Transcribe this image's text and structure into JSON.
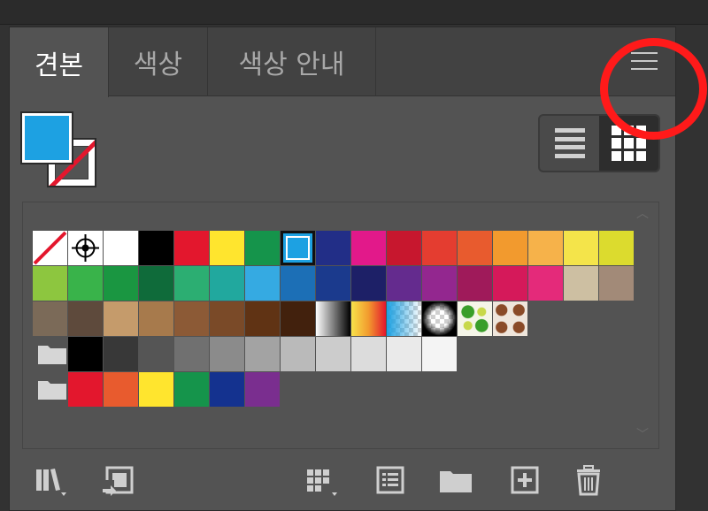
{
  "tabs": [
    {
      "label": "견본"
    },
    {
      "label": "색상"
    },
    {
      "label": "색상 안내"
    }
  ],
  "colors": {
    "fill": "#1da1e2",
    "stroke": "none",
    "highlight_ring": "#ff1a1a"
  },
  "icons": {
    "panel_menu": "hamburger-menu-icon",
    "list_view": "list-view-icon",
    "grid_view": "grid-view-icon",
    "library": "swatch-library-icon",
    "place": "place-swatches-icon",
    "kind": "show-swatch-kinds-icon",
    "options": "swatch-options-icon",
    "new_group": "new-color-group-icon",
    "new_swatch": "new-swatch-icon",
    "delete": "trash-icon"
  },
  "swatch_rows": [
    [
      "none",
      "registration",
      "#ffffff",
      "#000000",
      "#e3172d",
      "#ffe52e",
      "#15944b",
      "#1da1e2",
      "#222e87",
      "#e2198a",
      "#c7172e",
      "#e43d30",
      "#e85b2e",
      "#f29a2e",
      "#f6b24a",
      "#f4e44a",
      "#dcdb2e"
    ],
    [
      "#8dc63f",
      "#39b34a",
      "#1a9641",
      "#0f6b3a",
      "#2cae72",
      "#21a89e",
      "#35aae2",
      "#1c6fb6",
      "#1b3a8d",
      "#1d2067",
      "#642b8e",
      "#93278f",
      "#9f1a5a",
      "#d5195a",
      "#e42a7a",
      "#cdbfa2",
      "#a28a78"
    ],
    [
      "#7b6a58",
      "#5e4a3c",
      "#c59b6b",
      "#a77a4c",
      "#8c5a36",
      "#7a4a28",
      "#603314",
      "#42210d",
      "gradient-gray",
      "gradient-orange",
      "gradient-checker",
      "gradient-radial",
      "pattern-leaves",
      "pattern-swirl"
    ]
  ],
  "group_rows": [
    [
      "#000000",
      "#383838",
      "#555555",
      "#707070",
      "#8b8b8b",
      "#a3a3a3",
      "#bababa",
      "#cccccc",
      "#dcdcdc",
      "#eaeaea",
      "#f4f4f4"
    ],
    [
      "#e3172d",
      "#e85b2e",
      "#ffe52e",
      "#15944b",
      "#14328f",
      "#7a2e8f"
    ]
  ]
}
